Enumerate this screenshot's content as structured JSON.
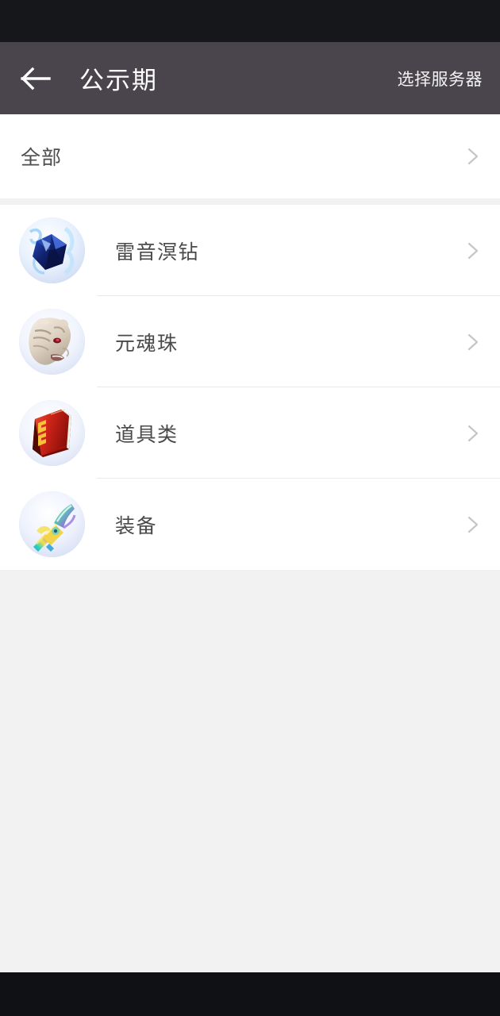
{
  "statusbar": {
    "background": "#15171b"
  },
  "header": {
    "title": "公示期",
    "action_label": "选择服务器",
    "back_icon": "arrow-left-icon",
    "background": "#4a444c",
    "text_color": "#ffffff"
  },
  "filter": {
    "label": "全部",
    "chevron_icon": "chevron-right-icon"
  },
  "list": {
    "items": [
      {
        "label": "雷音溟钻",
        "icon": "blue-gem-icon",
        "chevron_icon": "chevron-right-icon"
      },
      {
        "label": "元魂珠",
        "icon": "tiger-head-icon",
        "chevron_icon": "chevron-right-icon"
      },
      {
        "label": "道具类",
        "icon": "red-book-icon",
        "chevron_icon": "chevron-right-icon"
      },
      {
        "label": "装备",
        "icon": "rainbow-axe-icon",
        "chevron_icon": "chevron-right-icon"
      }
    ]
  },
  "colors": {
    "page_background": "#f2f2f2",
    "card_background": "#ffffff",
    "divider": "#e9e9ea",
    "chevron": "#c3c3c3",
    "label_text": "#4a4a4a"
  },
  "navbar": {
    "background": "#101115"
  }
}
